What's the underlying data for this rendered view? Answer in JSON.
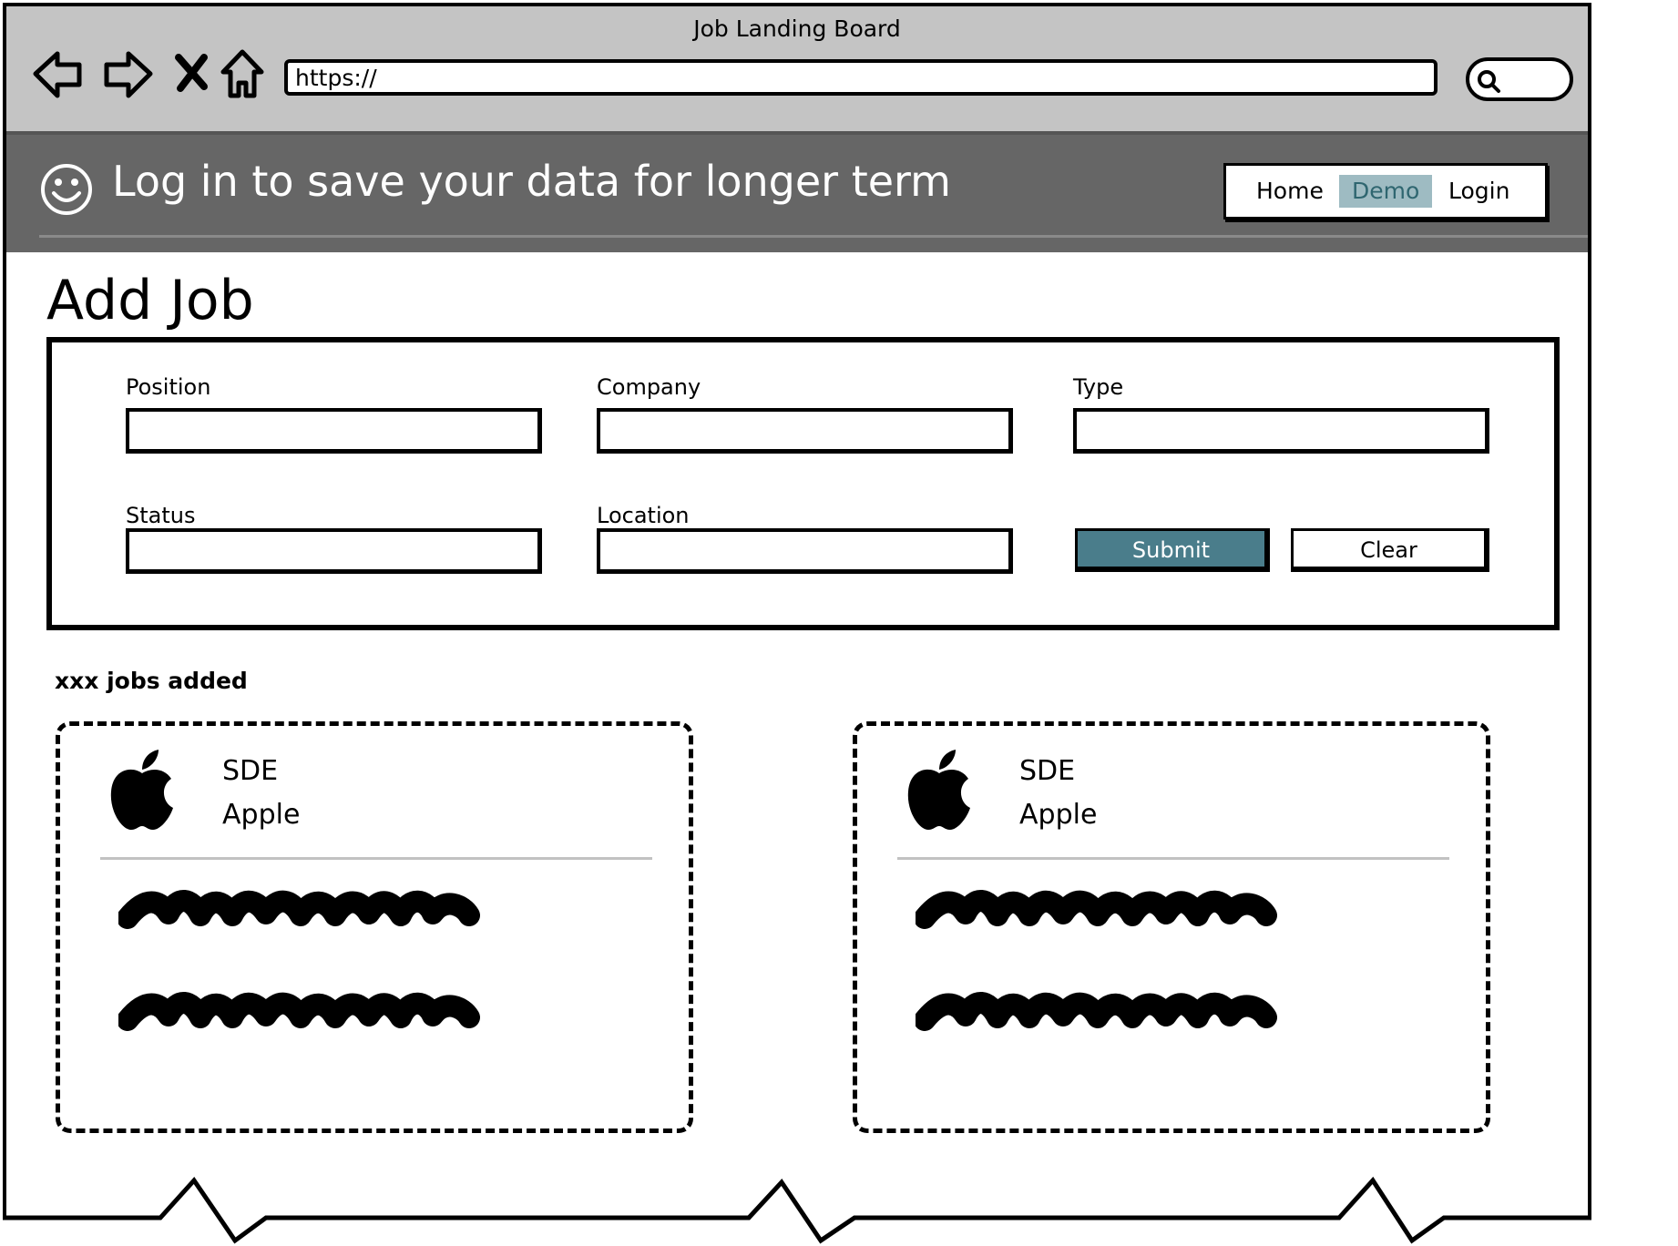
{
  "browser": {
    "title": "Job Landing Board",
    "url": "https://",
    "icons": [
      "back-arrow-icon",
      "forward-arrow-icon",
      "close-icon",
      "home-icon",
      "search-icon"
    ]
  },
  "banner": {
    "icon": "smiley-face-icon",
    "message": "Log in to save your data for longer term",
    "nav": [
      {
        "label": "Home",
        "active": false
      },
      {
        "label": "Demo",
        "active": true
      },
      {
        "label": "Login",
        "active": false
      }
    ]
  },
  "add_job": {
    "title": "Add Job",
    "fields": {
      "position": {
        "label": "Position",
        "value": ""
      },
      "company": {
        "label": "Company",
        "value": ""
      },
      "type": {
        "label": "Type",
        "value": ""
      },
      "status": {
        "label": "Status",
        "value": ""
      },
      "location": {
        "label": "Location",
        "value": ""
      }
    },
    "submit_label": "Submit",
    "clear_label": "Clear"
  },
  "jobs": {
    "count_text": "xxx jobs added",
    "cards": [
      {
        "position": "SDE",
        "company": "Apple",
        "logo": "apple-logo-icon"
      },
      {
        "position": "SDE",
        "company": "Apple",
        "logo": "apple-logo-icon"
      }
    ]
  },
  "colors": {
    "chrome_bg": "#c4c4c4",
    "banner_bg": "#666666",
    "nav_active_bg": "#9ebbc2",
    "submit_bg": "#4a7d8b"
  }
}
